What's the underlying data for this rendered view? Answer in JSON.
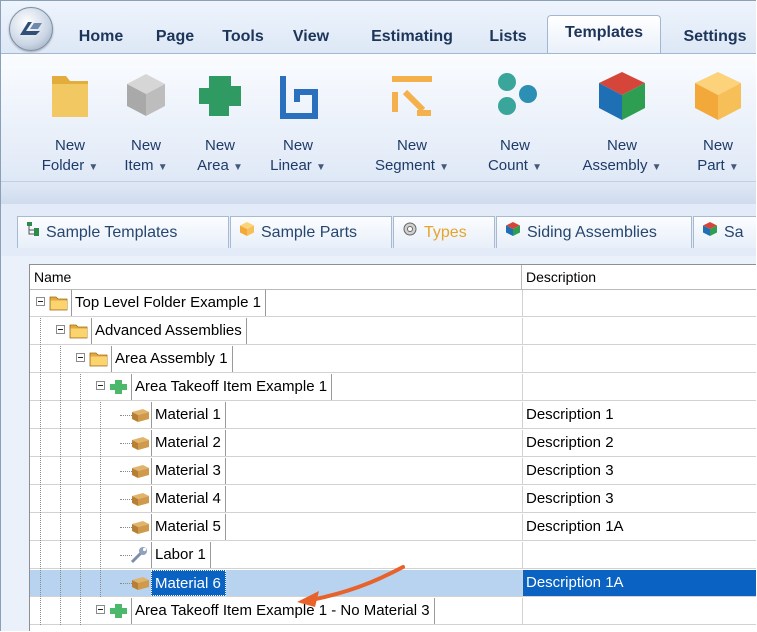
{
  "menu": {
    "tabs": [
      {
        "label": "Home"
      },
      {
        "label": "Page"
      },
      {
        "label": "Tools"
      },
      {
        "label": "View"
      },
      {
        "label": "Estimating"
      },
      {
        "label": "Lists"
      },
      {
        "label": "Templates"
      },
      {
        "label": "Settings"
      }
    ],
    "active_tab": "Templates"
  },
  "ribbon": {
    "buttons": [
      {
        "line1": "New",
        "line2": "Folder",
        "icon": "folder-icon",
        "color": "#f0c75e"
      },
      {
        "line1": "New",
        "line2": "Item",
        "icon": "gray-cube-icon",
        "color": "#b7b7b7"
      },
      {
        "line1": "New",
        "line2": "Area",
        "icon": "area-shape-icon",
        "color": "#3aa56a"
      },
      {
        "line1": "New",
        "line2": "Linear",
        "icon": "linear-shape-icon",
        "color": "#2b6fbf"
      },
      {
        "line1": "New",
        "line2": "Segment",
        "icon": "segment-shape-icon",
        "color": "#f4b04a"
      },
      {
        "line1": "New",
        "line2": "Count",
        "icon": "count-dots-icon",
        "color": "#3aa59a"
      },
      {
        "line1": "New",
        "line2": "Assembly",
        "icon": "assembly-cube-icon",
        "color": "#d13b3b"
      },
      {
        "line1": "New",
        "line2": "Part",
        "icon": "part-cube-icon",
        "color": "#f6b94a"
      }
    ],
    "dropdown_caret": "▼"
  },
  "doc_tabs": [
    {
      "label": "Sample Templates",
      "icon": "tree-icon",
      "active": false
    },
    {
      "label": "Sample Parts",
      "icon": "part-cube-icon",
      "active": false
    },
    {
      "label": "Types",
      "icon": "gear-icon",
      "active": true
    },
    {
      "label": "Siding Assemblies",
      "icon": "assembly-cube-icon",
      "active": false
    },
    {
      "label": "Sa",
      "icon": "assembly-cube-icon",
      "active": false
    }
  ],
  "grid": {
    "columns": [
      "Name",
      "Description"
    ],
    "rows": [
      {
        "name": "Top Level Folder Example 1",
        "description": "",
        "level": 0,
        "icon": "folder-icon",
        "expander": true
      },
      {
        "name": "Advanced Assemblies",
        "description": "",
        "level": 1,
        "icon": "folder-icon",
        "expander": true
      },
      {
        "name": "Area Assembly 1",
        "description": "",
        "level": 2,
        "icon": "folder-icon",
        "expander": true
      },
      {
        "name": "Area Takeoff Item Example 1",
        "description": "",
        "level": 3,
        "icon": "area-shape-icon",
        "expander": true
      },
      {
        "name": "Material 1",
        "description": "Description 1",
        "level": 4,
        "icon": "material-box-icon",
        "expander": false
      },
      {
        "name": "Material 2",
        "description": "Description 2",
        "level": 4,
        "icon": "material-box-icon",
        "expander": false
      },
      {
        "name": "Material 3",
        "description": "Description 3",
        "level": 4,
        "icon": "material-box-icon",
        "expander": false
      },
      {
        "name": "Material 4",
        "description": "Description 3",
        "level": 4,
        "icon": "material-box-icon",
        "expander": false
      },
      {
        "name": "Material 5",
        "description": "Description 1A",
        "level": 4,
        "icon": "material-box-icon",
        "expander": false
      },
      {
        "name": "Labor 1",
        "description": "",
        "level": 4,
        "icon": "wrench-icon",
        "expander": false
      },
      {
        "name": "Material 6",
        "description": "Description 1A",
        "level": 4,
        "icon": "material-box-icon",
        "expander": false,
        "selected": true
      },
      {
        "name": "Area Takeoff Item Example 1 - No Material 3",
        "description": "",
        "level": 3,
        "icon": "area-shape-icon",
        "expander": true
      }
    ]
  },
  "colors": {
    "selection": "#0a62c2",
    "selection_row": "#b8d3f0",
    "active_doc_tab_text": "#e5a42c",
    "annotation_arrow": "#e8622c"
  }
}
